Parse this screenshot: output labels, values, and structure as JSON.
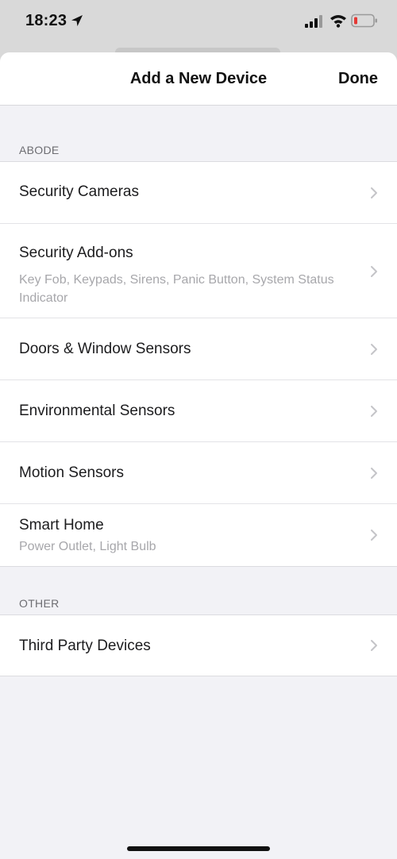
{
  "status_bar": {
    "time": "18:23",
    "icons": [
      "location-arrow-icon",
      "cellular-signal-icon",
      "wifi-icon",
      "battery-low-icon"
    ],
    "battery_color": "#e53935"
  },
  "nav": {
    "title": "Add a New Device",
    "done_label": "Done"
  },
  "sections": [
    {
      "header": "ABODE",
      "items": [
        {
          "label": "Security Cameras"
        },
        {
          "label": "Security Add-ons",
          "subtitle": "Key Fob, Keypads, Sirens, Panic Button, System Status Indicator"
        },
        {
          "label": "Doors & Window Sensors"
        },
        {
          "label": "Environmental Sensors"
        },
        {
          "label": "Motion Sensors"
        },
        {
          "label": "Smart Home",
          "subtitle": "Power Outlet, Light Bulb"
        }
      ]
    },
    {
      "header": "OTHER",
      "items": [
        {
          "label": "Third Party Devices"
        }
      ]
    }
  ],
  "colors": {
    "sheet_background": "#f2f2f6",
    "list_background": "#ffffff",
    "text_primary": "#1c1c1e",
    "text_secondary": "#a7a7ab",
    "section_header": "#6d6d72",
    "chevron": "#c4c4c8"
  }
}
